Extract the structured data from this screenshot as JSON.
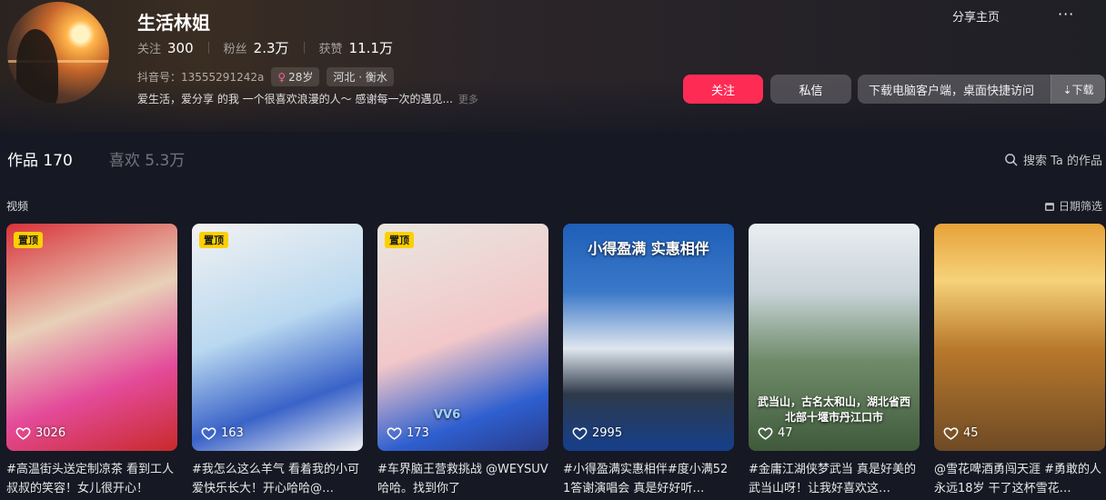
{
  "profile": {
    "name": "生活林姐",
    "stats": [
      {
        "label": "关注",
        "value": "300"
      },
      {
        "label": "粉丝",
        "value": "2.3万"
      },
      {
        "label": "获赞",
        "value": "11.1万"
      }
    ],
    "douyin_id": "抖音号：13555291242a",
    "age_tag": "28岁",
    "location_tag": "河北 · 衡水",
    "bio": "爱生活，爱分享 的我 一个很喜欢浪漫的人～ 感谢每一次的遇见...",
    "bio_more": "更多"
  },
  "header_actions": {
    "share": "分享主页",
    "more": "···",
    "follow": "关注",
    "message": "私信",
    "download_text": "下载电脑客户端，桌面快捷访问",
    "download_button": "⇣下载"
  },
  "tabs": [
    {
      "label": "作品 170",
      "active": true
    },
    {
      "label": "喜欢 5.3万",
      "active": false
    }
  ],
  "search_label": "搜索 Ta 的作品",
  "section_label": "视频",
  "date_filter_label": "日期筛选",
  "colors": {
    "accent": "#fe2c55",
    "pin": "#fcd000",
    "background": "#161823"
  },
  "videos": [
    {
      "pinned": true,
      "pin_label": "置顶",
      "likes": "3026",
      "caption": "#高温街头送定制凉茶 看到工人叔叔的笑容！女儿很开心！",
      "overlay": ""
    },
    {
      "pinned": true,
      "pin_label": "置顶",
      "likes": "163",
      "caption": "#我怎么这么羊气 看着我的小可爱快乐长大！开心哈哈@…",
      "overlay": ""
    },
    {
      "pinned": true,
      "pin_label": "置顶",
      "likes": "173",
      "caption": "#车界脑王营救挑战 @WEYSUV 哈哈。找到你了",
      "overlay": "VV6"
    },
    {
      "pinned": false,
      "pin_label": "",
      "likes": "2995",
      "caption": "#小得盈满实惠相伴#度小满521答谢演唱会 真是好好听…",
      "overlay": "小得盈满 实惠相伴"
    },
    {
      "pinned": false,
      "pin_label": "",
      "likes": "47",
      "caption": "#金庸江湖侠梦武当 真是好美的武当山呀！让我好喜欢这…",
      "overlay": "武当山，古名太和山，湖北省西北部十堰市丹江口市"
    },
    {
      "pinned": false,
      "pin_label": "",
      "likes": "45",
      "caption": "@雪花啤酒勇闯天涯 #勇敢的人永远18岁 干了这杯雪花…",
      "overlay": ""
    }
  ]
}
